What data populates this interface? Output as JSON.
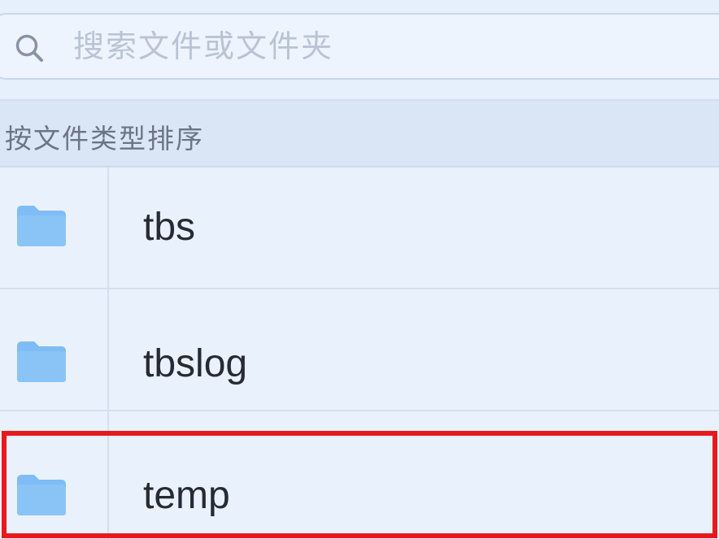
{
  "search": {
    "placeholder": "搜索文件或文件夹",
    "icon": "search-icon"
  },
  "section": {
    "label": "按文件类型排序"
  },
  "files": [
    {
      "name": "tbs",
      "icon": "folder-icon"
    },
    {
      "name": "tbslog",
      "icon": "folder-icon"
    },
    {
      "name": "temp",
      "icon": "folder-icon"
    }
  ],
  "colors": {
    "folder": "#7fbcf5",
    "highlight": "#e8191e"
  }
}
